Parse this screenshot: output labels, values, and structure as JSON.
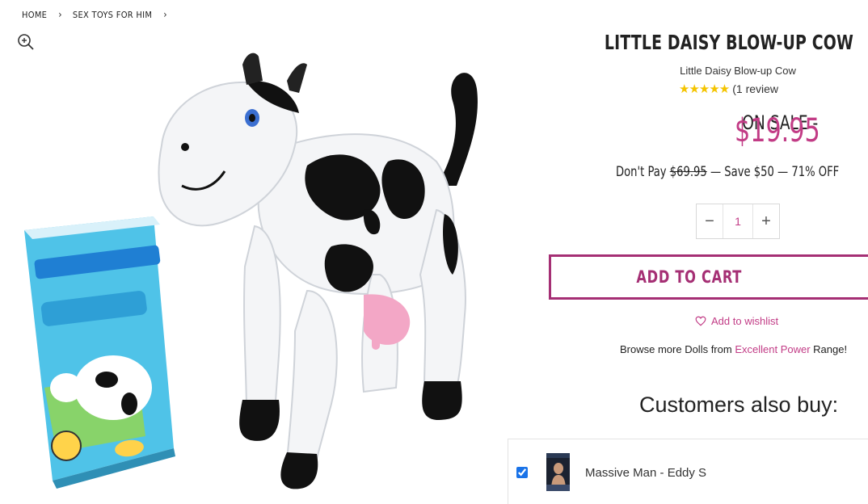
{
  "breadcrumb": {
    "items": [
      "HOME",
      "SEX TOYS FOR HIM"
    ],
    "separator": "›"
  },
  "product": {
    "title": "LITTLE DAISY BLOW-UP COW",
    "subtitle": "Little Daisy Blow-up Cow",
    "stars": "★★★★★",
    "review_text": "(1 review",
    "rating_out_of_5": 5,
    "sale_label": "ON SALE -",
    "sale_price": "$19.95",
    "dont_pay_label": "Don't Pay",
    "old_price": "$69.95",
    "savings_text": "— Save $50 — 71% OFF"
  },
  "quantity": {
    "minus": "−",
    "value": "1",
    "plus": "+"
  },
  "cart": {
    "add_to_cart": "ADD TO CART"
  },
  "wishlist": {
    "label": "Add to wishlist"
  },
  "browse": {
    "prefix": "Browse more Dolls from",
    "brand": "Excellent Power",
    "suffix": "Range!"
  },
  "also_buy": {
    "title": "Customers also buy:",
    "items": [
      {
        "name": "Massive Man - Eddy S",
        "checked": true
      }
    ]
  },
  "colors": {
    "accent": "#c23c86",
    "button_border": "#a52f74",
    "star": "#f4c400"
  },
  "icons": {
    "zoom": "zoom-in-icon",
    "wishlist": "heart-icon"
  }
}
